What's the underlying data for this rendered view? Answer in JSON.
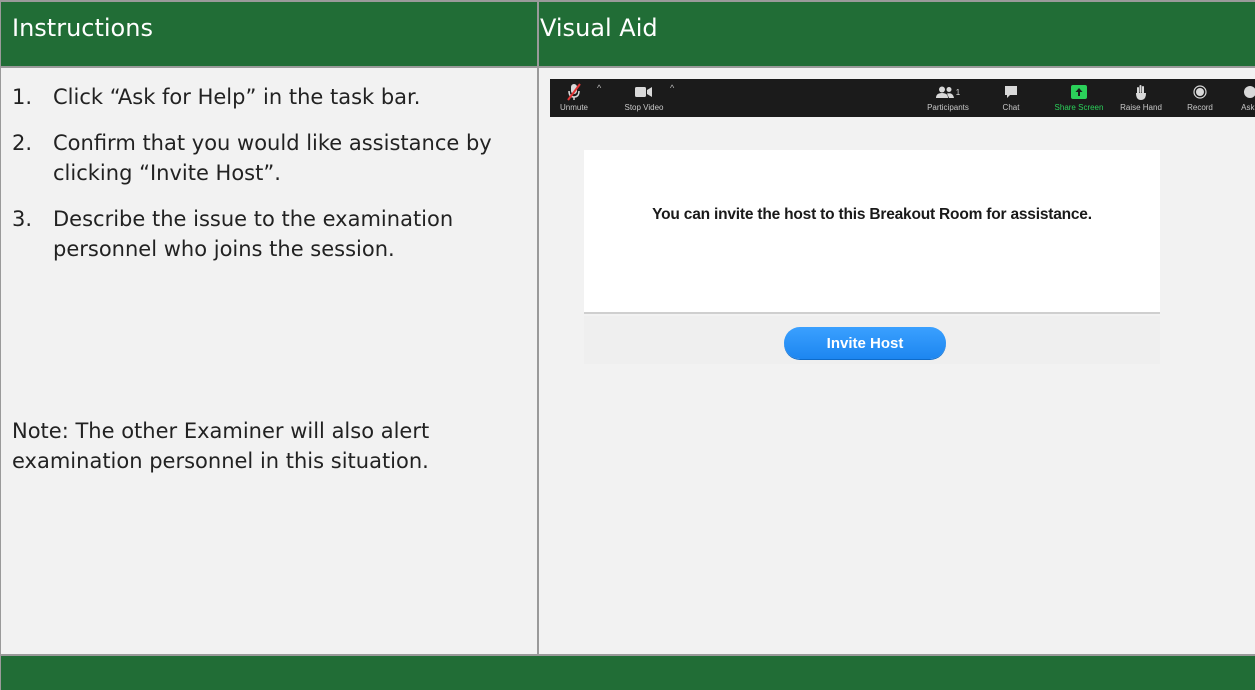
{
  "header": {
    "instructions_title": "Instructions",
    "visual_aid_title": "Visual Aid"
  },
  "steps": [
    {
      "num": "1.",
      "text": "Click “Ask for Help” in the task bar."
    },
    {
      "num": "2.",
      "text": "Confirm that you would like assistance by clicking “Invite Host”."
    },
    {
      "num": "3.",
      "text": "Describe the issue to the examination personnel who joins the session."
    }
  ],
  "note": "Note: The other Examiner will also alert examination personnel in this situation.",
  "toolbar": {
    "unmute": "Unmute",
    "stop_video": "Stop Video",
    "participants": "Participants",
    "participants_count": "1",
    "chat": "Chat",
    "share_screen": "Share Screen",
    "raise_hand": "Raise Hand",
    "record": "Record",
    "ask_for_help": "Ask f"
  },
  "dialog": {
    "message": "You can invite the host to this Breakout Room for assistance.",
    "button": "Invite Host"
  },
  "colors": {
    "header_green": "#216d36",
    "share_green": "#2bd15a",
    "button_blue": "#1d86f0"
  }
}
